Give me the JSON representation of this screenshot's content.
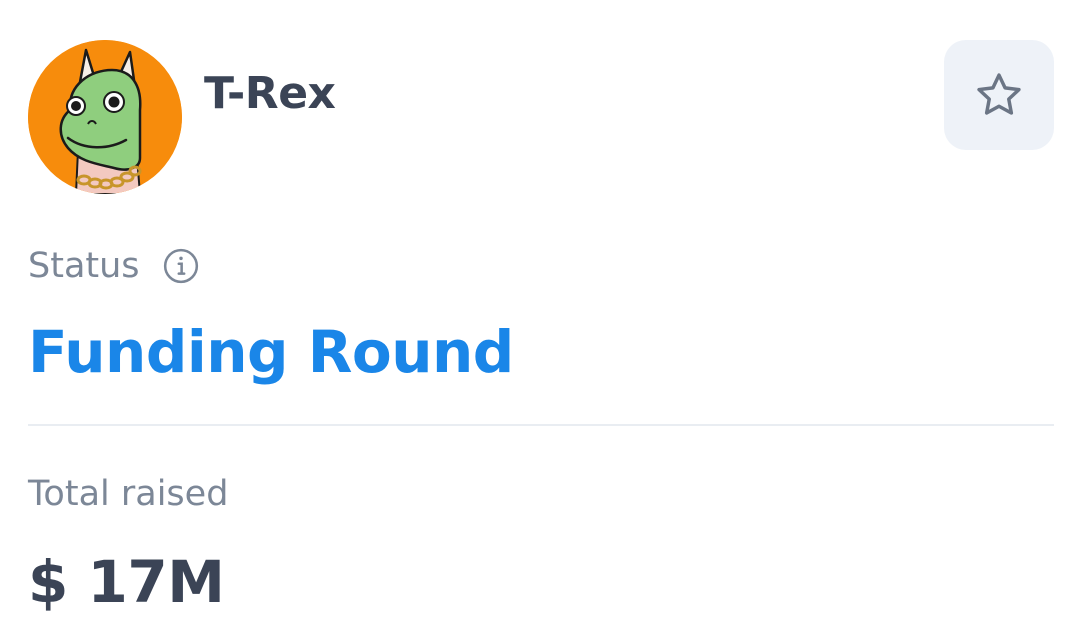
{
  "project": {
    "name": "T-Rex",
    "avatar_icon": "dino-avatar-icon",
    "avatar_bg": "#f78c0c"
  },
  "favorite": {
    "icon": "star-outline-icon"
  },
  "status": {
    "label": "Status",
    "info_icon": "info-circle-icon",
    "value": "Funding Round",
    "value_color": "#1a86e8"
  },
  "raised": {
    "label": "Total raised",
    "value": "$ 17M"
  }
}
